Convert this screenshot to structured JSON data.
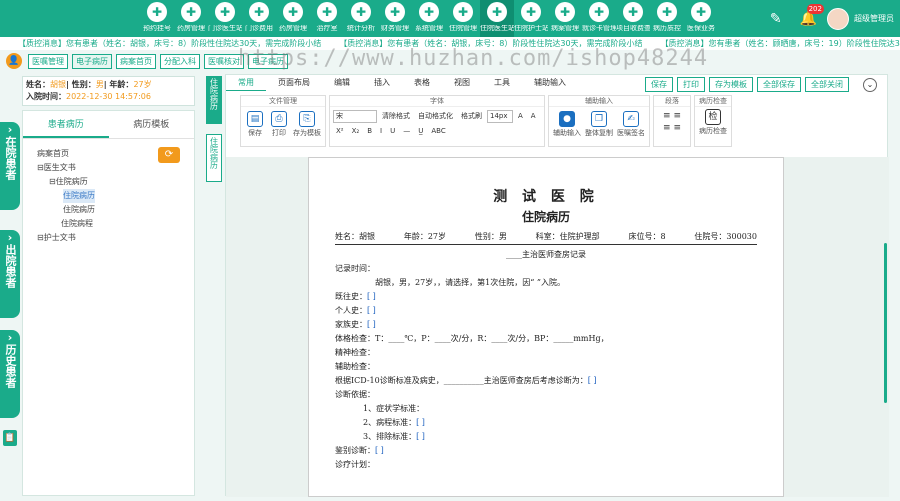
{
  "topnav": [
    {
      "label": "预约挂号",
      "icon": "calendar-icon"
    },
    {
      "label": "药房管理",
      "icon": "pill-icon"
    },
    {
      "label": "门诊医生站",
      "icon": "doctor-icon"
    },
    {
      "label": "门诊费用",
      "icon": "yen-icon"
    },
    {
      "label": "药房管理",
      "icon": "medicine-icon"
    },
    {
      "label": "治疗室",
      "icon": "treatment-icon"
    },
    {
      "label": "统计分析",
      "icon": "chart-icon"
    },
    {
      "label": "财务管理",
      "icon": "finance-icon"
    },
    {
      "label": "系统管理",
      "icon": "gear-icon"
    },
    {
      "label": "住院管理",
      "icon": "bed-icon"
    },
    {
      "label": "住院医生站",
      "icon": "doctor-icon"
    },
    {
      "label": "住院护士站",
      "icon": "nurse-icon"
    },
    {
      "label": "病案管理",
      "icon": "folder-icon"
    },
    {
      "label": "就诊卡管理",
      "icon": "card-icon"
    },
    {
      "label": "项目收费查询",
      "icon": "search-icon"
    },
    {
      "label": "病历质控",
      "icon": "check-icon"
    },
    {
      "label": "医保业务",
      "icon": "shield-icon"
    }
  ],
  "topbar": {
    "badge": "202",
    "user_name": "超级管理员"
  },
  "marquee": [
    "【质控消息】您有患者（姓名：胡银，床号：8）阶段性住院达30天，需完成阶段小结",
    "【质控消息】您有患者（姓名：胡银，床号：8）阶段性住院达30天，需完成阶段小结",
    "【质控消息】您有患者（姓名：顾晒唐，床号：19）阶段性住院达30天，需完成阶段小结",
    "【质控消息】您"
  ],
  "toolbar2": {
    "buttons": [
      "医嘱管理",
      "电子病历",
      "病案首页",
      "分配入科",
      "医嘱核对",
      "电子病历"
    ]
  },
  "patient": {
    "name_label": "姓名：",
    "name": "胡银",
    "sex_label": "| 性别：",
    "sex": "男",
    "age_label": "| 年龄：",
    "age": "27岁",
    "admit_label": "入院时间：",
    "admit_time": "2022-12-30 14:57:06"
  },
  "sidetabs": {
    "in": "在院患者",
    "out": "出院患者",
    "history": "历史患者"
  },
  "leftpanel": {
    "tabs": [
      "患者病历",
      "病历模板"
    ],
    "tree": {
      "home": "病案首页",
      "doctor": "医生文书",
      "inpatient": "住院病历",
      "inpatient_rec": "住院病历",
      "inpatient_rec2": "住院病历",
      "course": "住院病程",
      "nurse": "护士文书"
    }
  },
  "vtabs": {
    "t1": "住院病历",
    "t2": "住院病历"
  },
  "menutabs": [
    "常用",
    "页面布局",
    "编辑",
    "插入",
    "表格",
    "视图",
    "工具",
    "辅助输入"
  ],
  "actions": [
    "保存",
    "打印",
    "存为模板",
    "全部保存",
    "全部关闭"
  ],
  "ribbon": {
    "file_title": "文件管理",
    "file": [
      "保存",
      "打印",
      "存为模板"
    ],
    "font_title": "字体",
    "font_name": "宋",
    "font_size": "14px",
    "font_items": [
      "清除格式",
      "自动格式化",
      "格式刷",
      "A",
      "A",
      "X²",
      "X₂",
      "B",
      "I",
      "U",
      "—",
      "U̲",
      "ABC",
      "A",
      "▲"
    ],
    "assist_title": "辅助输入",
    "assist": [
      "辅助输入",
      "整体复制",
      "医嘱签名"
    ],
    "para_title": "段落",
    "check_title": "病历检查",
    "check": [
      "病历检查"
    ]
  },
  "doc": {
    "title": "测 试 医 院",
    "subtitle": "住院病历",
    "header": {
      "name": "姓名：胡银",
      "age": "年龄：27岁",
      "sex": "性别：男",
      "dept": "科室：住院护理部",
      "bed": "床位号：8",
      "admno": "住院号：300030"
    },
    "record_title": "____主治医师查房记录",
    "record_time": "记录时间：",
    "intro": "胡银，男，27岁，，请选择，第1次住院，因“ ”入院。",
    "past": "既往史：",
    "personal": "个人史：",
    "family": "家族史：",
    "vitals": "体格检查：T：____℃，P：____次/分，R：____次/分，BP：_____mmHg，",
    "mental": "精神检查：",
    "aux": "辅助检查：",
    "icd": "根据ICD-10诊断标准及病史，__________主治医师查房后考虑诊断为：",
    "basis": "诊断依据：",
    "c1": "1、症状学标准：",
    "c2": "2、病程标准：",
    "c3": "3、排除标准：",
    "diff": "鉴别诊断：",
    "plan": "诊疗计划：",
    "bracket": "[ ]"
  },
  "watermark": "https://www.huzhan.com/ishop48244"
}
